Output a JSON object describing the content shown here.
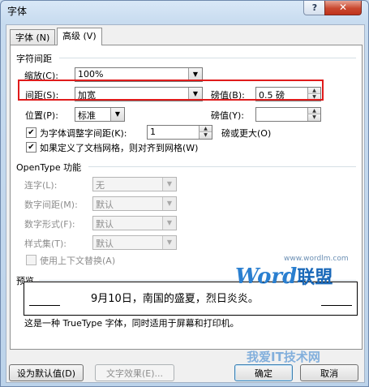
{
  "window": {
    "title": "字体",
    "help": "?",
    "close": "✕"
  },
  "tabs": [
    {
      "label": "字体 (N)",
      "active": false
    },
    {
      "label": "高级 (V)",
      "active": true
    }
  ],
  "spacing": {
    "section_title": "字符间距",
    "scale": {
      "label": "缩放(C):",
      "value": "100%"
    },
    "spacing": {
      "label": "间距(S):",
      "value": "加宽"
    },
    "spacing_by": {
      "label": "磅值(B):",
      "value": "0.5 磅"
    },
    "position": {
      "label": "位置(P):",
      "value": "标准"
    },
    "position_by": {
      "label": "磅值(Y):",
      "value": ""
    },
    "kerning": {
      "label": "为字体调整字间距(K):",
      "value": "1",
      "suffix": "磅或更大(O)",
      "checked": true
    },
    "grid": {
      "label": "如果定义了文档网格，则对齐到网格(W)",
      "checked": true
    }
  },
  "opentype": {
    "section_title": "OpenType 功能",
    "ligatures": {
      "label": "连字(L):",
      "value": "无"
    },
    "num_spacing": {
      "label": "数字间距(M):",
      "value": "默认"
    },
    "num_forms": {
      "label": "数字形式(F):",
      "value": "默认"
    },
    "stylistic_sets": {
      "label": "样式集(T):",
      "value": "默认"
    },
    "contextual": {
      "label": "使用上下文替换(A)",
      "checked": false
    }
  },
  "preview": {
    "section_title": "预览",
    "sample": "9月10日，南国的盛夏，烈日炎炎。",
    "description": "这是一种 TrueType 字体，同时适用于屏幕和打印机。"
  },
  "buttons": {
    "set_default": "设为默认值(D)",
    "text_effects": "文字效果(E)...",
    "ok": "确定",
    "cancel": "取消"
  },
  "watermark": {
    "url": "www.wordlm.com",
    "word": "Word",
    "cn": "联盟",
    "bottom": "我爱IT技术网"
  },
  "colors": {
    "highlight": "#e01b1b",
    "titlebar": "#c7dbef",
    "close": "#c9482f"
  }
}
